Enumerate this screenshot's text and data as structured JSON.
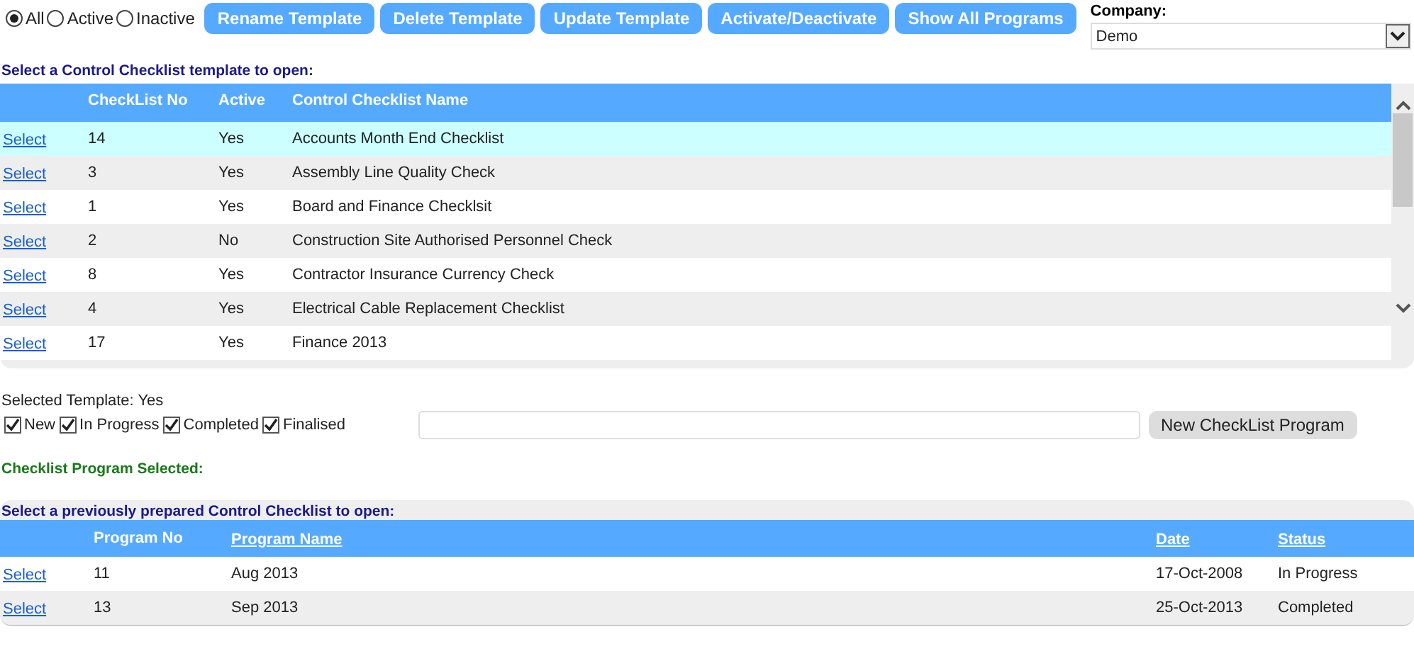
{
  "filter": [
    {
      "label": "All",
      "selected": true
    },
    {
      "label": "Active",
      "selected": false
    },
    {
      "label": "Inactive",
      "selected": false
    }
  ],
  "toolbar_buttons": [
    "Rename Template",
    "Delete Template",
    "Update Template",
    "Activate/Deactivate",
    "Show All Programs"
  ],
  "company": {
    "label": "Company:",
    "value": "Demo"
  },
  "templates": {
    "title": "Select a Control Checklist template to open:",
    "columns": [
      "CheckList No",
      "Active",
      "Control Checklist Name"
    ],
    "rows": [
      {
        "link": "Select",
        "no": "14",
        "active": "Yes",
        "name": "Accounts Month End Checklist",
        "selected": true
      },
      {
        "link": "Select",
        "no": "3",
        "active": "Yes",
        "name": "Assembly Line Quality Check",
        "selected": false
      },
      {
        "link": "Select",
        "no": "1",
        "active": "Yes",
        "name": "Board and Finance Checklsit",
        "selected": false
      },
      {
        "link": "Select",
        "no": "2",
        "active": "No",
        "name": "Construction Site Authorised Personnel Check",
        "selected": false
      },
      {
        "link": "Select",
        "no": "8",
        "active": "Yes",
        "name": "Contractor Insurance Currency Check",
        "selected": false
      },
      {
        "link": "Select",
        "no": "4",
        "active": "Yes",
        "name": "Electrical Cable Replacement Checklist",
        "selected": false
      },
      {
        "link": "Select",
        "no": "17",
        "active": "Yes",
        "name": "Finance 2013",
        "selected": false
      }
    ]
  },
  "selected_template": "Selected Template: Yes",
  "status_filters": [
    {
      "label": "New",
      "checked": true
    },
    {
      "label": "In Progress",
      "checked": true
    },
    {
      "label": "Completed",
      "checked": true
    },
    {
      "label": "Finalised",
      "checked": true
    }
  ],
  "new_program_button": "New CheckList Program",
  "program_selected": "Checklist Program Selected:",
  "programs": {
    "title": "Select a previously prepared Control Checklist to open:",
    "columns": [
      {
        "label": "Program No",
        "sortable": false
      },
      {
        "label": "Program Name",
        "sortable": true
      },
      {
        "label": "Date",
        "sortable": true
      },
      {
        "label": "Status",
        "sortable": true
      }
    ],
    "rows": [
      {
        "link": "Select",
        "no": "11",
        "name": "Aug 2013",
        "date": "17-Oct-2008",
        "status": "In Progress"
      },
      {
        "link": "Select",
        "no": "13",
        "name": "Sep 2013",
        "date": "25-Oct-2013",
        "status": "Completed"
      }
    ]
  }
}
